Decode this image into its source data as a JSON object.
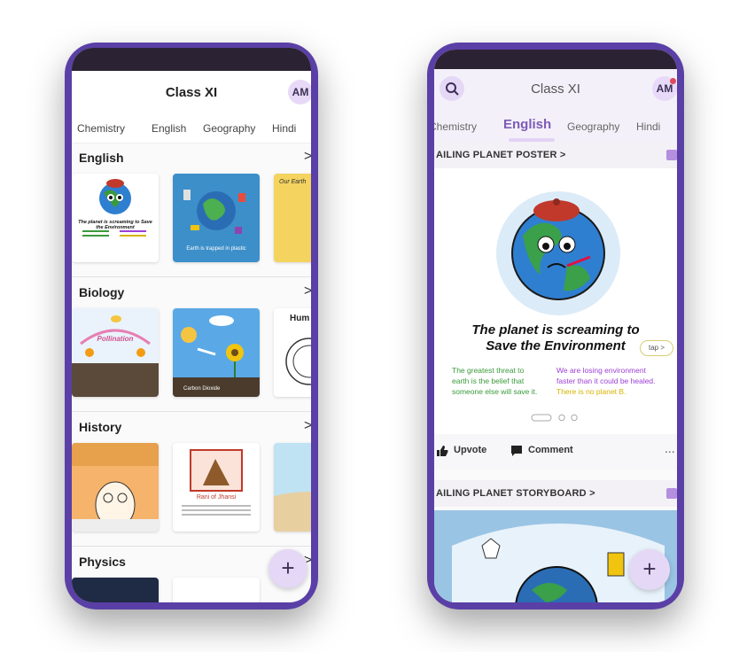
{
  "left_screen": {
    "header": {
      "title": "Class XI",
      "avatar": "AM"
    },
    "tabs": [
      "Chemistry",
      "English",
      "Geography",
      "Hindi"
    ],
    "sections": [
      {
        "title": "English",
        "arrow": ">",
        "cards": [
          {
            "caption": "The planet is screaming to Save the Environment"
          },
          {
            "caption": "Earth is trapped in plastic"
          },
          {
            "caption": "Our Earth"
          }
        ]
      },
      {
        "title": "Biology",
        "arrow": ">",
        "cards": [
          {
            "caption": "Pollination"
          },
          {
            "caption": "Carbon Dioxide"
          },
          {
            "caption": "Hum"
          }
        ]
      },
      {
        "title": "History",
        "arrow": ">",
        "cards": [
          {
            "caption": ""
          },
          {
            "caption": "Rani of Jhansi"
          },
          {
            "caption": ""
          }
        ]
      },
      {
        "title": "Physics",
        "arrow": ">"
      }
    ],
    "fab": "+"
  },
  "right_screen": {
    "header": {
      "title": "Class XI",
      "avatar": "AM"
    },
    "tabs": [
      "Chemistry",
      "English",
      "Geography",
      "Hindi"
    ],
    "active_tab": "English",
    "post1": {
      "title": "AILING PLANET POSTER",
      "arrow": ">",
      "tap_label": "tap >",
      "headline_line1": "The planet is screaming to",
      "headline_line2": "Save the Environment",
      "left_text": [
        "The greatest threat to",
        "earth is the belief that",
        "someone else will save it."
      ],
      "right_text": [
        "We are losing environment",
        "faster than it could be healed."
      ],
      "right_text_2": "There is no planet B.",
      "upvote": "Upvote",
      "comment": "Comment",
      "more": "..."
    },
    "post2": {
      "title": "AILING PLANET STORYBOARD",
      "arrow": ">"
    },
    "fab": "+"
  },
  "colors": {
    "frame": "#5a3fa6",
    "accent": "#7c5bb8",
    "fab": "#e5d8f6",
    "green_text": "#3a9a3a",
    "purple_text": "#9b3fd6",
    "yellow_text": "#d6b400"
  }
}
